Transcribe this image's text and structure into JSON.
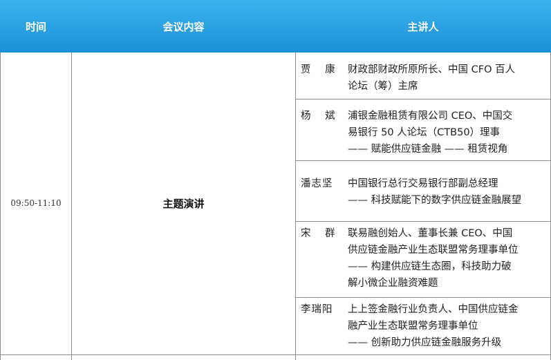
{
  "header": {
    "time_label": "时间",
    "content_label": "会议内容",
    "speaker_label": "主讲人"
  },
  "session": {
    "time": "09:50-11:10",
    "content": "主题演讲"
  },
  "speakers": [
    {
      "name": "贾  康",
      "lines": [
        "财政部财政所原所长、中国 CFO 百人",
        "论坛（筹）主席"
      ]
    },
    {
      "name": "杨  斌",
      "lines": [
        "浦银金融租赁有限公司 CEO、中国交",
        "易银行 50 人论坛（CTB50）理事",
        "—— 赋能供应链金融 —— 租赁视角"
      ]
    },
    {
      "name": "潘志坚",
      "lines": [
        "中国银行总行交易银行部副总经理",
        "—— 科技赋能下的数字供应链金融展望"
      ]
    },
    {
      "name": "宋  群",
      "lines": [
        "联易融创始人、董事长兼 CEO、中国",
        "供应链金融产业生态联盟常务理事单位",
        "—— 构建供应链生态圈，科技助力破",
        "解小微企业融资难题"
      ]
    },
    {
      "name": "李瑞阳",
      "lines": [
        "上上签金融行业负责人、中国供应链金",
        "融产业生态联盟常务理事单位",
        "—— 创新助力供应链金融服务升级"
      ]
    }
  ],
  "colors": {
    "header_top": "#3ab3ec",
    "header_bottom": "#1d8fd6",
    "header_text": "#ffffff",
    "grid": "#8a8a8a"
  }
}
